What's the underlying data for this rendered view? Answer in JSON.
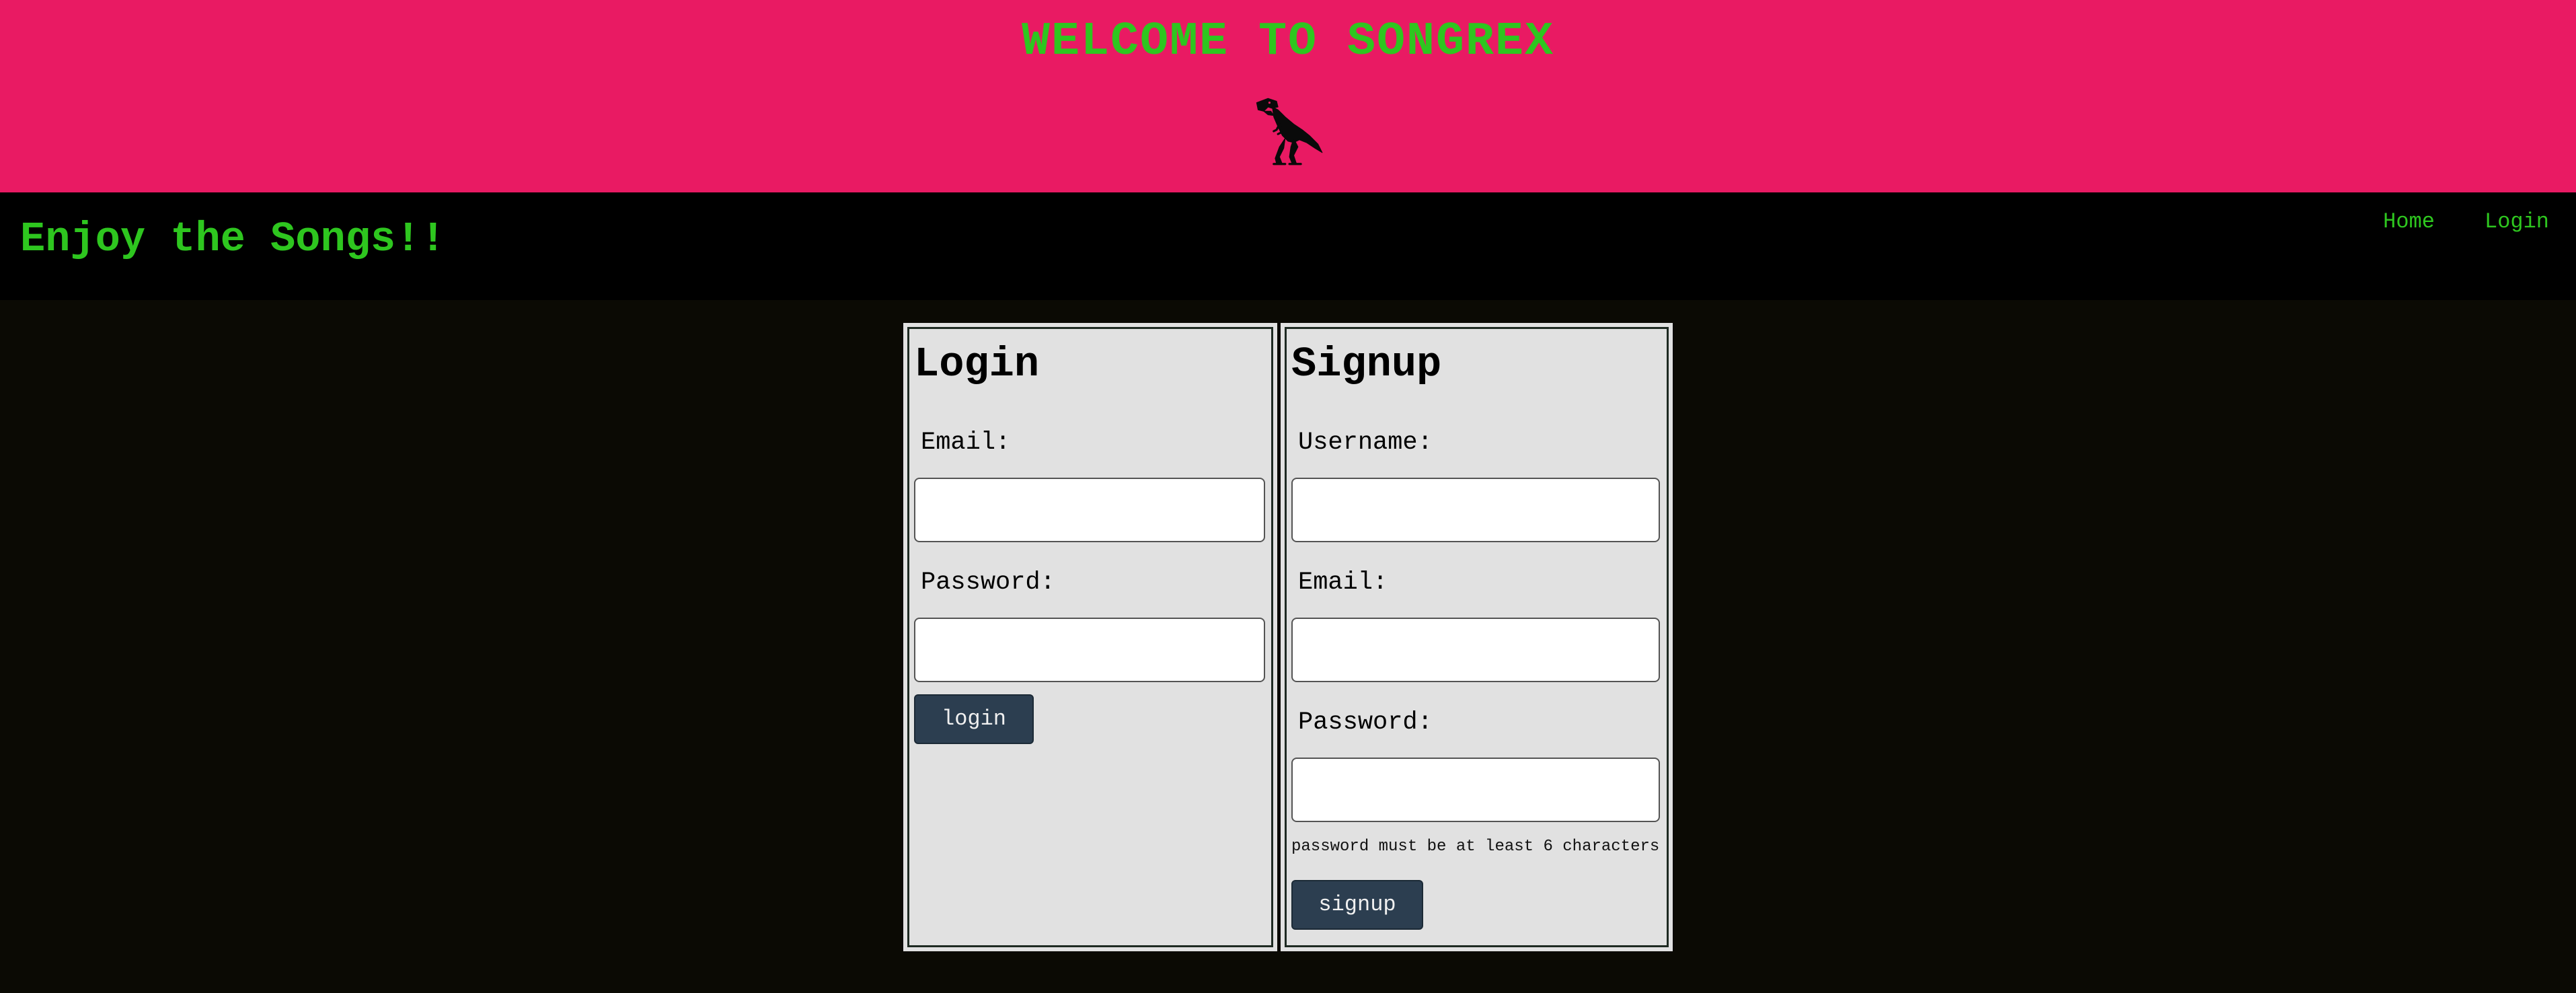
{
  "header": {
    "title": "WELCOME TO SONGREX",
    "logo": "t-rex-dinosaur-logo"
  },
  "nav": {
    "tagline": "Enjoy the Songs!!",
    "links": [
      {
        "label": "Home"
      },
      {
        "label": "Login"
      }
    ]
  },
  "login": {
    "title": "Login",
    "email_label": "Email:",
    "email_value": "",
    "password_label": "Password:",
    "password_value": "",
    "button_label": "login"
  },
  "signup": {
    "title": "Signup",
    "username_label": "Username:",
    "username_value": "",
    "email_label": "Email:",
    "email_value": "",
    "password_label": "Password:",
    "password_value": "",
    "password_hint": "password must be at least 6 characters",
    "button_label": "signup"
  },
  "colors": {
    "header_bg": "#e91a63",
    "nav_bg": "#000000",
    "page_bg": "#0b0a04",
    "accent_green": "#2ec61f",
    "panel_bg": "#e1e1e1",
    "button_bg": "#2c3e50"
  }
}
